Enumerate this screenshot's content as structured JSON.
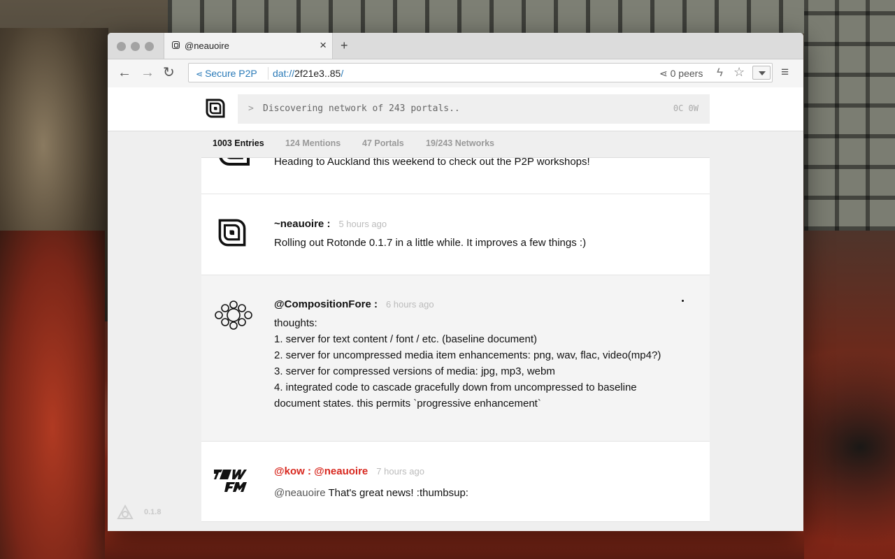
{
  "tab": {
    "title": "@neauoire"
  },
  "nav": {
    "secure_label": "Secure P2P",
    "url_scheme": "dat://",
    "url_host": "2f21e3..85",
    "url_tail": "/",
    "peers": "0 peers"
  },
  "header": {
    "prompt": ">",
    "command": "Discovering network of 243 portals..",
    "counts": "0C 0W"
  },
  "feed_tabs": [
    {
      "label": "1003 Entries"
    },
    {
      "label": "124 Mentions"
    },
    {
      "label": "47 Portals"
    },
    {
      "label": "19/243 Networks"
    }
  ],
  "entries": [
    {
      "message": "Heading to Auckland this weekend to check out the P2P workshops!"
    },
    {
      "author": "~neauoire :",
      "time": "5 hours ago",
      "message": "Rolling out Rotonde 0.1.7 in a little while. It improves a few things :)"
    },
    {
      "author": "@CompositionFore :",
      "time": "6 hours ago",
      "lines": [
        "thoughts:",
        "1. server for text content / font / etc. (baseline document)",
        "2. server for uncompressed media item enhancements: png, wav, flac, video(mp4?)",
        "3. server for compressed versions of media: jpg, mp3, webm",
        "4. integrated code to cascade gracefully down from uncompressed to baseline document states. this permits `progressive enhancement`"
      ]
    },
    {
      "author": "@kow : @neauoire",
      "time": "7 hours ago",
      "mention": "@neauoire",
      "message": "That's great news! :thumbsup:"
    }
  ],
  "footer": {
    "version": "0.1.8"
  },
  "colors": {
    "link_blue": "#2a7ab8",
    "reply_red": "#d8281f"
  }
}
